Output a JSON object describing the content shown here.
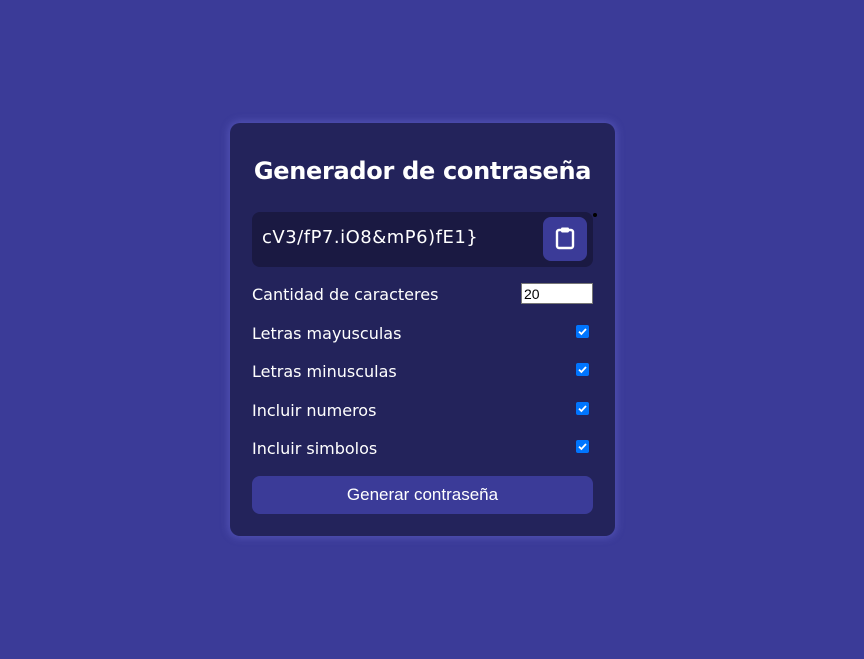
{
  "colors": {
    "background": "#3b3b98",
    "card": "#23235b",
    "result_box": "#1a1942",
    "button": "#3b3b98",
    "checkbox": "#0075ff"
  },
  "title": "Generador de contraseña",
  "result": {
    "password": "cV3/fP7.iO8&mP6)fE1}",
    "copy_icon": "clipboard-icon"
  },
  "settings": {
    "length": {
      "label": "Cantidad de caracteres",
      "value": "20"
    },
    "uppercase": {
      "label": "Letras mayusculas",
      "checked": true
    },
    "lowercase": {
      "label": "Letras minusculas",
      "checked": true
    },
    "numbers": {
      "label": "Incluir numeros",
      "checked": true
    },
    "symbols": {
      "label": "Incluir simbolos",
      "checked": true
    }
  },
  "generate_button": "Generar contraseña"
}
